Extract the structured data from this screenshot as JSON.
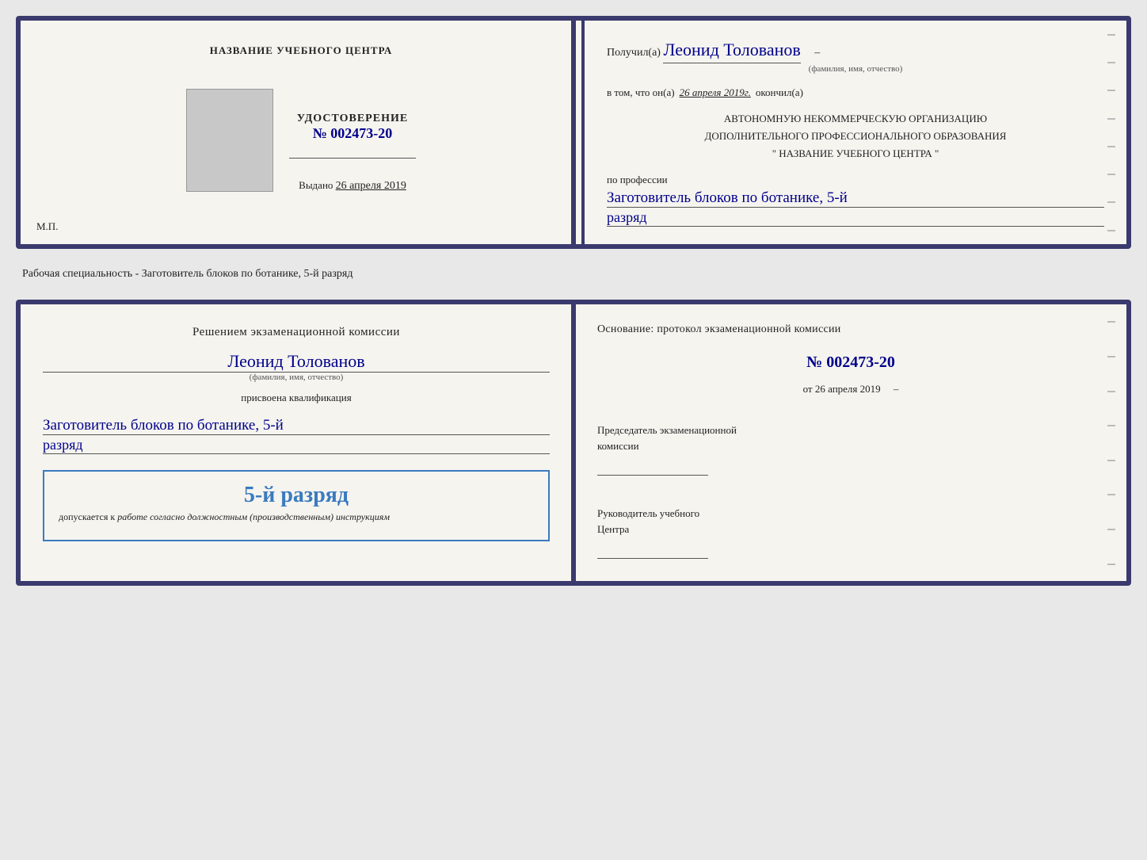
{
  "card1": {
    "left": {
      "training_center": "НАЗВАНИЕ УЧЕБНОГО ЦЕНТРА",
      "cert_label": "УДОСТОВЕРЕНИЕ",
      "cert_number": "№ 002473-20",
      "issued_label": "Выдано",
      "issued_date": "26 апреля 2019",
      "mp": "М.П."
    },
    "right": {
      "received_prefix": "Получил(а)",
      "received_name": "Леонид Толованов",
      "fio_label": "(фамилия, имя, отчество)",
      "vtom_prefix": "в том, что он(а)",
      "vtom_date": "26 апреля 2019г.",
      "vtom_suffix": "окончил(а)",
      "org_line1": "АВТОНОМНУЮ НЕКОММЕРЧЕСКУЮ ОРГАНИЗАЦИЮ",
      "org_line2": "ДОПОЛНИТЕЛЬНОГО ПРОФЕССИОНАЛЬНОГО ОБРАЗОВАНИЯ",
      "org_line3": "\"    НАЗВАНИЕ УЧЕБНОГО ЦЕНТРА    \"",
      "profession_label": "по профессии",
      "profession_name": "Заготовитель блоков по ботанике, 5-й",
      "razryad": "разряд"
    }
  },
  "specialty_text": "Рабочая специальность - Заготовитель блоков по ботанике, 5-й разряд",
  "card2": {
    "left": {
      "commission_text": "Решением экзаменационной комиссии",
      "person_name": "Леонид Толованов",
      "fio_label": "(фамилия, имя, отчество)",
      "qualification_label": "присвоена квалификация",
      "qualification_name": "Заготовитель блоков по ботанике, 5-й",
      "razryad": "разряд",
      "stamp_grade": "5-й разряд",
      "stamp_prefix": "допускается к",
      "stamp_italic": "работе согласно должностным (производственным) инструкциям"
    },
    "right": {
      "basis_label": "Основание: протокол экзаменационной комиссии",
      "protocol_number": "№  002473-20",
      "from_label": "от",
      "from_date": "26 апреля 2019",
      "chairman_line1": "Председатель экзаменационной",
      "chairman_line2": "комиссии",
      "director_line1": "Руководитель учебного",
      "director_line2": "Центра"
    }
  }
}
